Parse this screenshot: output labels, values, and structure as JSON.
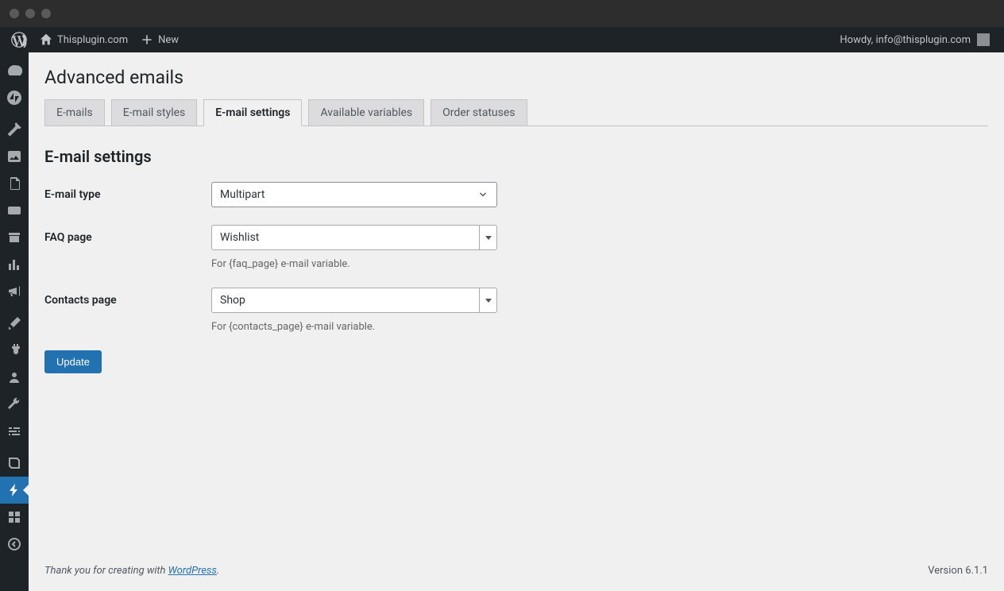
{
  "adminBar": {
    "siteName": "Thisplugin.com",
    "newLabel": "New",
    "howdy": "Howdy, info@thisplugin.com"
  },
  "page": {
    "title": "Advanced emails",
    "tabs": [
      "E-mails",
      "E-mail styles",
      "E-mail settings",
      "Available variables",
      "Order statuses"
    ],
    "activeTab": 2
  },
  "section": {
    "title": "E-mail settings"
  },
  "fields": {
    "emailType": {
      "label": "E-mail type",
      "value": "Multipart"
    },
    "faqPage": {
      "label": "FAQ page",
      "value": "Wishlist",
      "helper": "For {faq_page} e-mail variable."
    },
    "contactsPage": {
      "label": "Contacts page",
      "value": "Shop",
      "helper": "For {contacts_page} e-mail variable."
    }
  },
  "submit": {
    "label": "Update"
  },
  "footer": {
    "thanksPrefix": "Thank you for creating with ",
    "wordpress": "WordPress",
    "version": "Version 6.1.1"
  }
}
